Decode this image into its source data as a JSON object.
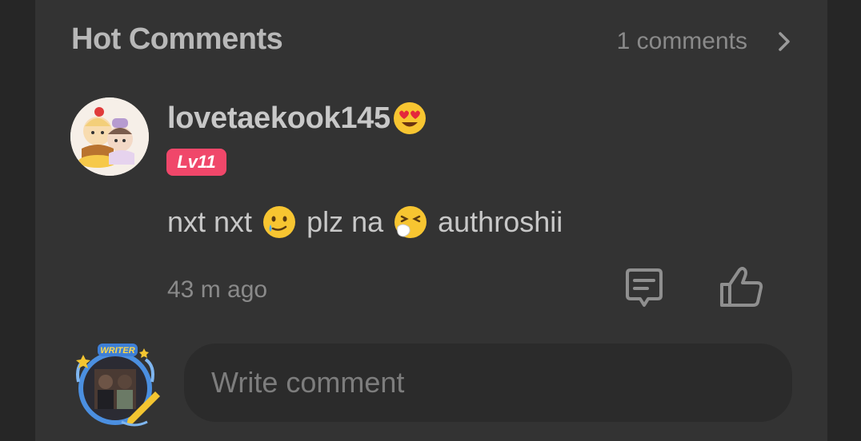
{
  "header": {
    "title": "Hot Comments",
    "count": "1 comments"
  },
  "comment": {
    "username": "lovetaekook145",
    "level": "Lv11",
    "text_parts": [
      "nxt nxt",
      "plz na",
      "authroshii"
    ],
    "time": "43 m ago"
  },
  "composer": {
    "placeholder": "Write comment",
    "badge": "WRITER"
  },
  "icons": {
    "chevron": "chevron-right-icon",
    "reply": "reply-icon",
    "like": "thumbs-up-icon"
  },
  "colors": {
    "background": "#333333",
    "level_badge": "#f0476a",
    "text": "#c8c8c8",
    "muted": "#8a8a8a"
  }
}
